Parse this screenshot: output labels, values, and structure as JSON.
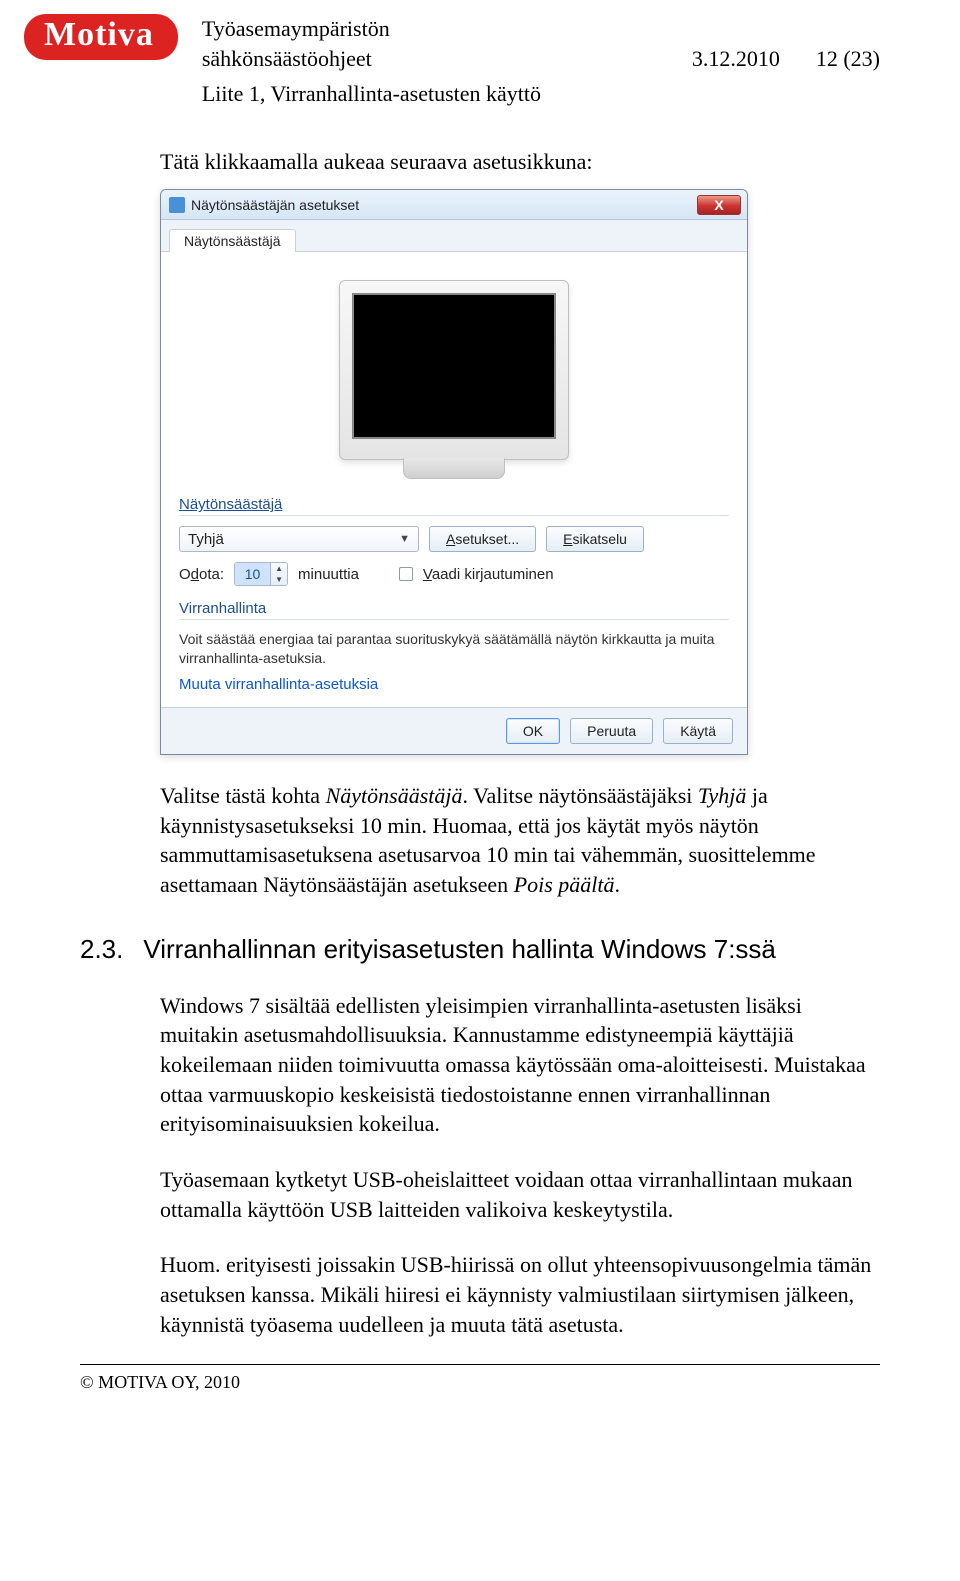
{
  "header": {
    "logo": "Motiva",
    "title_line1": "Työasemaympäristön",
    "title_line2": "sähkönsäästöohjeet",
    "date": "3.12.2010",
    "page": "12 (23)",
    "subtitle": "Liite 1, Virranhallinta-asetusten käyttö"
  },
  "intro": "Tätä klikkaamalla aukeaa seuraava asetusikkuna:",
  "dialog": {
    "title": "Näytönsäästäjän asetukset",
    "close_x": "X",
    "tab": "Näytönsäästäjä",
    "group1_title": "Näytönsäästäjä",
    "dropdown_value": "Tyhjä",
    "btn_settings": "Asetukset...",
    "btn_preview": "Esikatselu",
    "wait_label": "Odota:",
    "wait_value": "10",
    "wait_unit": "minuuttia",
    "require_login": "Vaadi kirjautuminen",
    "group2_title": "Virranhallinta",
    "pm_text": "Voit säästää energiaa tai parantaa suorituskykyä säätämällä näytön kirkkautta ja muita virranhallinta-asetuksia.",
    "pm_link": "Muuta virranhallinta-asetuksia",
    "btn_ok": "OK",
    "btn_cancel": "Peruuta",
    "btn_apply": "Käytä"
  },
  "body": {
    "p1_a": "Valitse tästä kohta ",
    "p1_i1": "Näytönsäästäjä",
    "p1_b": ". Valitse näytönsäästäjäksi ",
    "p1_i2": "Tyhjä",
    "p1_c": " ja käynnistysasetukseksi 10 min. Huomaa, että jos käytät myös näytön sammuttamisasetuksena asetusarvoa 10 min tai vähemmän, suosittelemme asettamaan Näytönsäästäjän asetukseen ",
    "p1_i3": "Pois päältä",
    "p1_d": ".",
    "sect_num": "2.3.",
    "sect_title": "Virranhallinnan erityisasetusten hallinta Windows 7:ssä",
    "p2": "Windows 7 sisältää edellisten yleisimpien virranhallinta-asetusten lisäksi muitakin asetusmahdollisuuksia. Kannustamme edistyneempiä käyttäjiä kokeilemaan niiden toimivuutta omassa käytössään oma-aloitteisesti. Muistakaa ottaa varmuuskopio keskeisistä tiedostoistanne ennen virranhallinnan erityisominaisuuksien kokeilua.",
    "p3": "Työasemaan kytketyt USB-oheislaitteet voidaan ottaa virranhallintaan mukaan ottamalla käyttöön USB laitteiden valikoiva keskeytystila.",
    "p4": "Huom. erityisesti joissakin USB-hiirissä on ollut yhteensopivuusongelmia tämän asetuksen kanssa. Mikäli hiiresi ei käynnisty valmiustilaan siirtymisen jälkeen, käynnistä työasema uudelleen ja muuta tätä asetusta."
  },
  "footer": {
    "copyright_pre": "© M",
    "copyright_sc": "OTIVA ",
    "copyright_post": "OY, 2010"
  }
}
